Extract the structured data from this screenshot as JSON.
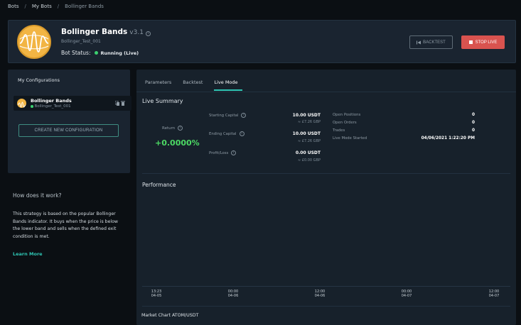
{
  "breadcrumb": [
    "Bots",
    "My Bots",
    "Bollinger Bands"
  ],
  "bot": {
    "name": "Bollinger Bands",
    "version": "v3.1",
    "config_name": "Bollinger_Test_001",
    "status_label": "Bot Status:",
    "status_value": "Running (Live)"
  },
  "actions": {
    "backtest_label": "BACKTEST",
    "stop_label": "STOP LIVE"
  },
  "configurations": {
    "title": "My Configurations",
    "items": [
      {
        "name": "Bollinger Bands",
        "sub": "Bollinger_Test_001"
      }
    ],
    "create_label": "CREATE NEW CONFIGURATION"
  },
  "how": {
    "title": "How does it work?",
    "description": "This strategy is based on the popular Bollinger Bands indicator. It buys when the price is below the lower band and sells when the defined exit condition is met.",
    "learn_more": "Learn More"
  },
  "tabs": [
    "Parameters",
    "Backtest",
    "Live Mode"
  ],
  "active_tab": "Live Mode",
  "live_summary": {
    "title": "Live Summary",
    "return_label": "Return",
    "return_value": "+0.0000%",
    "metrics": [
      {
        "label": "Starting Capital",
        "value": "10.00 USDT",
        "sub": "≈ £7.26 GBP"
      },
      {
        "label": "Ending Capital",
        "value": "10.00 USDT",
        "sub": "≈ £7.26 GBP"
      },
      {
        "label": "Profit/Loss",
        "value": "0.00 USDT",
        "sub": "≈ £0.00 GBP"
      }
    ],
    "stats": [
      {
        "label": "Open Positions",
        "value": "0"
      },
      {
        "label": "Open Orders",
        "value": "0"
      },
      {
        "label": "Trades",
        "value": "0"
      },
      {
        "label": "Live Mode Started",
        "value": "04/06/2021 1:22:20 PM"
      }
    ]
  },
  "performance": {
    "title": "Performance",
    "x_ticks": [
      {
        "time": "13:23",
        "date": "04-05"
      },
      {
        "time": "00:00",
        "date": "04-06"
      },
      {
        "time": "12:00",
        "date": "04-06"
      },
      {
        "time": "00:00",
        "date": "04-07"
      },
      {
        "time": "12:00",
        "date": "04-07"
      }
    ]
  },
  "market_chart": {
    "title": "Market Chart ATOM/USDT"
  },
  "colors": {
    "accent": "#2ec4b2",
    "danger": "#d9534f",
    "positive": "#4cd964",
    "logo": "#f2b544"
  }
}
